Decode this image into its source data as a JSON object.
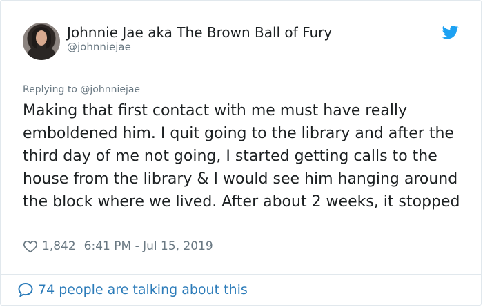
{
  "tweet": {
    "author_name": "Johnnie Jae aka The Brown Ball of Fury",
    "author_handle": "@johnniejae",
    "reply_to": "Replying to @johnniejae",
    "text": "Making that first contact with me must have really emboldened him. I quit going to the library and after the third day of me not going, I started getting calls to the house from the library & I would see him hanging around the block where we lived. After about 2 weeks, it stopped",
    "likes": "1,842",
    "timestamp": "6:41 PM - Jul 15, 2019",
    "conversation": "74 people are talking about this"
  },
  "icons": {
    "brand": "twitter-bird-icon",
    "like": "heart-icon",
    "conversation": "speech-bubble-icon"
  },
  "colors": {
    "text": "#1c2022",
    "muted": "#697882",
    "link": "#2b7bb9",
    "twitter_blue": "#1da1f2",
    "border": "#e1e8ed"
  }
}
